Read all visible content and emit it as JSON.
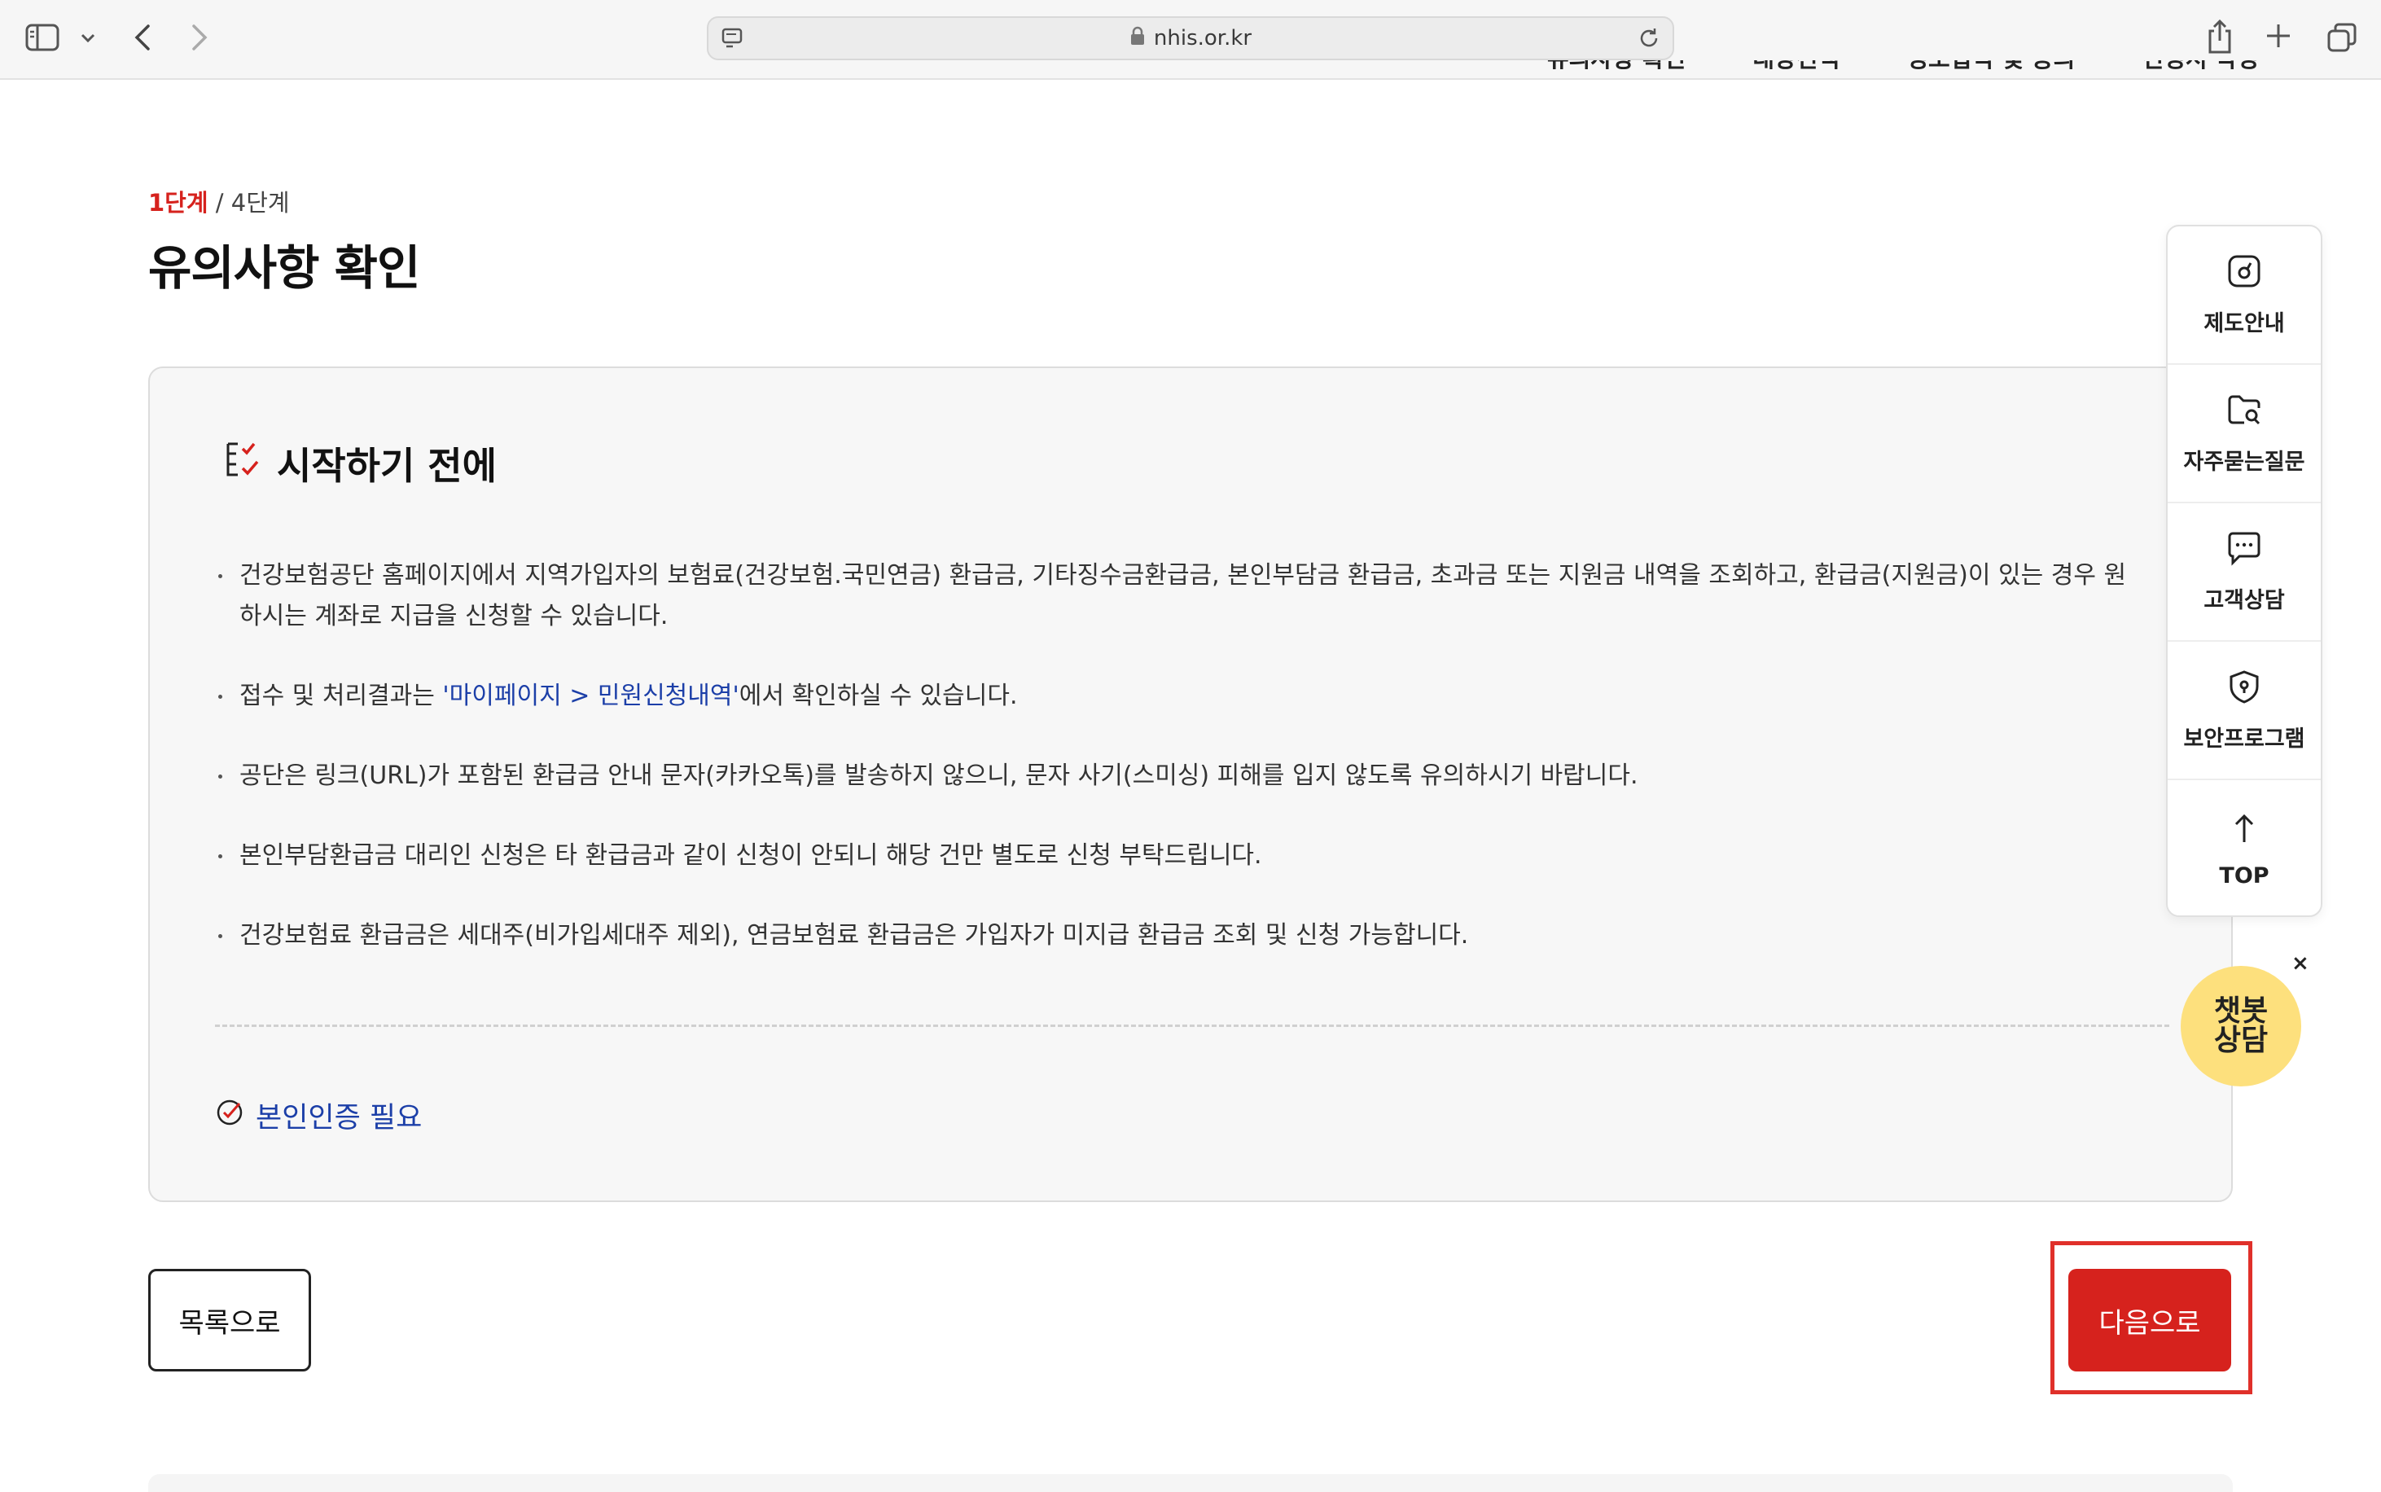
{
  "browser": {
    "url": "nhis.or.kr"
  },
  "topnav": {
    "items": [
      "유의사항 확인",
      "대상선택",
      "정보입력 및 동의",
      "신청서 작성"
    ]
  },
  "step": {
    "current": "1단계",
    "total": " / 4단계"
  },
  "page_title": "유의사항 확인",
  "notice": {
    "title": "시작하기 전에",
    "bullets": [
      {
        "text": "건강보험공단 홈페이지에서 지역가입자의 보험료(건강보험.국민연금) 환급금, 기타징수금환급금, 본인부담금 환급금, 초과금 또는 지원금 내역을 조회하고, 환급금(지원금)이 있는 경우 원하시는 계좌로 지급을 신청할 수 있습니다."
      },
      {
        "pre": "접수 및 처리결과는 ",
        "link": "'마이페이지 > 민원신청내역'",
        "post": "에서 확인하실 수 있습니다."
      },
      {
        "text": "공단은 링크(URL)가 포함된 환급금 안내 문자(카카오톡)를 발송하지 않으니, 문자 사기(스미싱) 피해를 입지 않도록 유의하시기 바랍니다."
      },
      {
        "text": "본인부담환급금 대리인 신청은 타 환급금과 같이 신청이 안되니 해당 건만 별도로 신청 부탁드립니다."
      },
      {
        "text": "건강보험료 환급금은 세대주(비가입세대주 제외), 연금보험료 환급금은 가입자가 미지급 환급금 조회 및 신청 가능합니다."
      }
    ],
    "auth_label": "본인인증 필요"
  },
  "buttons": {
    "list": "목록으로",
    "next": "다음으로"
  },
  "quick_menu": {
    "items": [
      {
        "label": "제도안내",
        "icon": "document-icon"
      },
      {
        "label": "자주묻는질문",
        "icon": "folder-search-icon"
      },
      {
        "label": "고객상담",
        "icon": "chat-icon"
      },
      {
        "label": "보안프로그램",
        "icon": "shield-icon"
      },
      {
        "label": "TOP",
        "icon": "arrow-up-icon"
      }
    ]
  },
  "chatbot": {
    "label": "챗봇\n상담",
    "close": "×"
  },
  "colors": {
    "accent": "#d6221d",
    "link": "#1c3fa8",
    "chatbot": "#fde07d"
  }
}
